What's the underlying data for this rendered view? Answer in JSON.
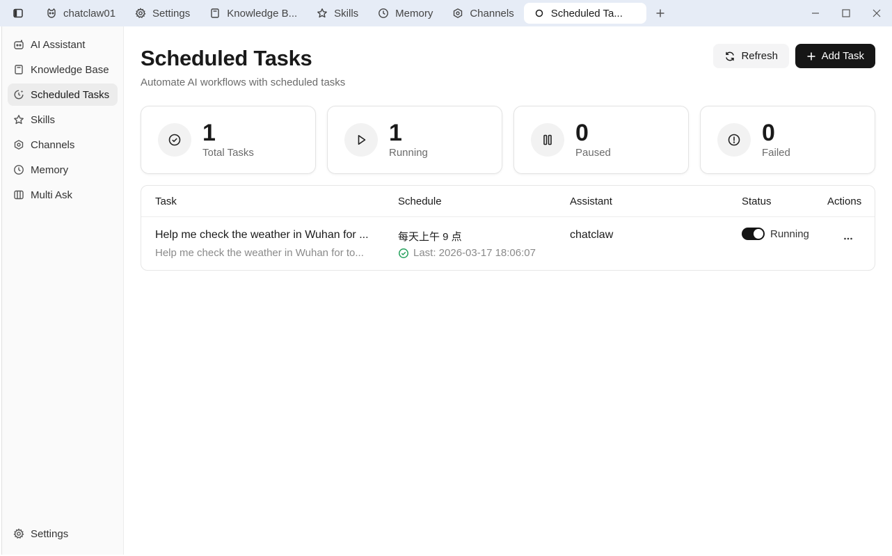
{
  "tabs": [
    {
      "label": "chatclaw01",
      "icon": "cat-face-icon"
    },
    {
      "label": "Settings",
      "icon": "gear-icon"
    },
    {
      "label": "Knowledge B...",
      "icon": "book-icon"
    },
    {
      "label": "Skills",
      "icon": "star-icon"
    },
    {
      "label": "Memory",
      "icon": "clock-icon"
    },
    {
      "label": "Channels",
      "icon": "hub-icon"
    },
    {
      "label": "Scheduled Ta...",
      "icon": "circle-icon",
      "active": true
    }
  ],
  "sidebar": {
    "items": [
      {
        "label": "AI Assistant",
        "icon": "bot-icon"
      },
      {
        "label": "Knowledge Base",
        "icon": "book-icon"
      },
      {
        "label": "Scheduled Tasks",
        "icon": "clock-spark-icon",
        "active": true
      },
      {
        "label": "Skills",
        "icon": "star-icon"
      },
      {
        "label": "Channels",
        "icon": "hub-icon"
      },
      {
        "label": "Memory",
        "icon": "clock-icon"
      },
      {
        "label": "Multi Ask",
        "icon": "columns-icon"
      }
    ],
    "bottom": {
      "label": "Settings",
      "icon": "gear-icon"
    }
  },
  "page": {
    "title": "Scheduled Tasks",
    "subtitle": "Automate AI workflows with scheduled tasks",
    "refresh_label": "Refresh",
    "add_label": "Add Task"
  },
  "stats": [
    {
      "value": "1",
      "label": "Total Tasks",
      "icon": "check-circle-icon"
    },
    {
      "value": "1",
      "label": "Running",
      "icon": "play-icon"
    },
    {
      "value": "0",
      "label": "Paused",
      "icon": "pause-icon"
    },
    {
      "value": "0",
      "label": "Failed",
      "icon": "alert-circle-icon"
    }
  ],
  "table": {
    "headers": {
      "task": "Task",
      "schedule": "Schedule",
      "assistant": "Assistant",
      "status": "Status",
      "actions": "Actions"
    },
    "rows": [
      {
        "title": "Help me check the weather in Wuhan for ...",
        "description": "Help me check the weather in Wuhan for to...",
        "schedule": "每天上午 9 点",
        "last_run": "Last: 2026-03-17 18:06:07",
        "assistant": "chatclaw",
        "status": "Running",
        "enabled": true
      }
    ]
  },
  "colors": {
    "accent": "#161616",
    "success": "#22a05a",
    "tabbar": "#e6ecf6"
  }
}
